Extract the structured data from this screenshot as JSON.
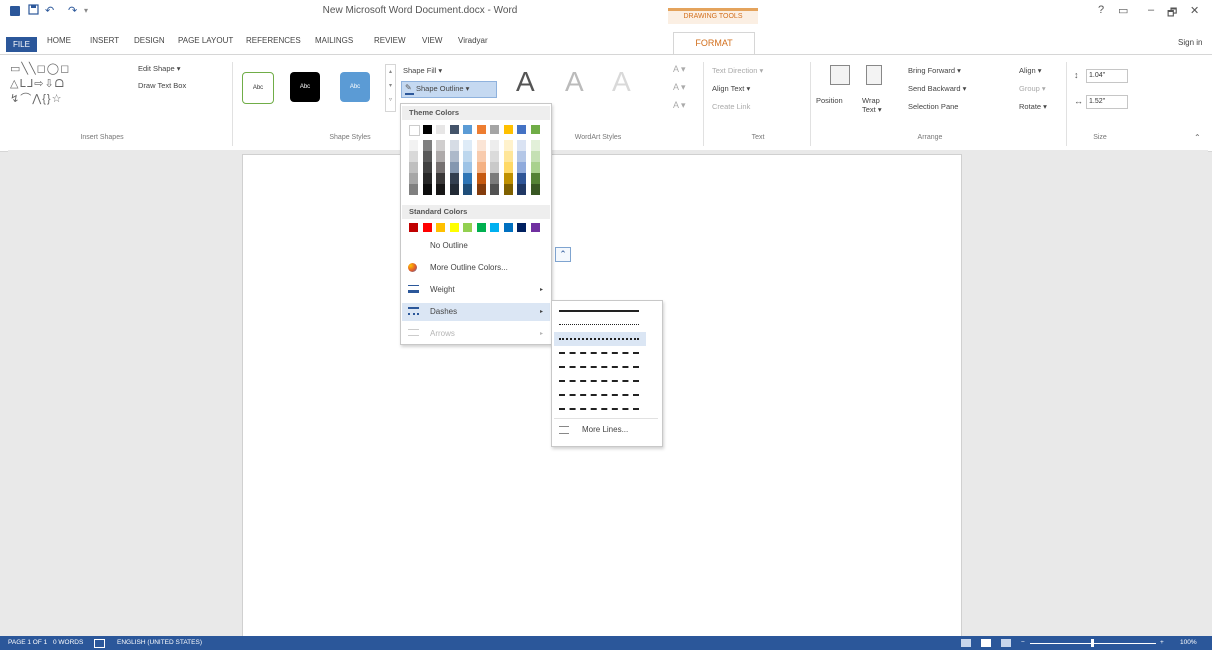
{
  "window": {
    "title": "New Microsoft Word Document.docx - Word",
    "contextual_group": "DRAWING TOOLS",
    "help": "?",
    "controls": [
      "▭",
      "–",
      "🗗",
      "✕"
    ],
    "sign_in": "Sign in"
  },
  "quick_access": {
    "undo": "↶",
    "redo": "↷",
    "more": "▾"
  },
  "tabs": [
    "FILE",
    "HOME",
    "INSERT",
    "DESIGN",
    "PAGE LAYOUT",
    "REFERENCES",
    "MAILINGS",
    "REVIEW",
    "VIEW",
    "Viradyar",
    "FORMAT"
  ],
  "ribbon": {
    "insert_shapes": {
      "label": "Insert Shapes",
      "edit_shape": "Edit Shape ▾",
      "draw_text_box": "Draw Text Box"
    },
    "shape_styles": {
      "label": "Shape Styles",
      "style_label": "Abc",
      "shape_fill": "Shape Fill ▾",
      "shape_outline": "Shape Outline ▾"
    },
    "wordart_styles": {
      "label": "WordArt Styles",
      "letter": "A"
    },
    "text": {
      "label": "Text",
      "text_direction": "Text Direction ▾",
      "align_text": "Align Text ▾",
      "create_link": "Create Link"
    },
    "arrange": {
      "label": "Arrange",
      "position": "Position",
      "wrap_text": "Wrap Text ▾",
      "bring_forward": "Bring Forward ▾",
      "send_backward": "Send Backward ▾",
      "selection_pane": "Selection Pane",
      "align": "Align ▾",
      "group": "Group ▾",
      "rotate": "Rotate ▾"
    },
    "size": {
      "label": "Size",
      "height": "1.04\"",
      "width": "1.52\""
    }
  },
  "outline_menu": {
    "theme_colors_header": "Theme Colors",
    "standard_colors_header": "Standard Colors",
    "items": [
      {
        "label": "No Outline",
        "icon": "none"
      },
      {
        "label": "More Outline Colors...",
        "icon": "palette-icon"
      },
      {
        "label": "Weight",
        "icon": "weight-icon",
        "submenu": true
      },
      {
        "label": "Dashes",
        "icon": "dashes-icon",
        "submenu": true,
        "highlighted": true
      },
      {
        "label": "Arrows",
        "icon": "arrows-icon",
        "submenu": true,
        "disabled": true
      }
    ],
    "theme_top_row": [
      "#ffffff",
      "#000000",
      "#e7e6e6",
      "#44546a",
      "#5b9bd5",
      "#ed7d31",
      "#a5a5a5",
      "#ffc000",
      "#4472c4",
      "#70ad47"
    ],
    "theme_columns": [
      [
        "#f2f2f2",
        "#d9d9d9",
        "#bfbfbf",
        "#a6a6a6",
        "#808080"
      ],
      [
        "#7f7f7f",
        "#595959",
        "#404040",
        "#262626",
        "#0d0d0d"
      ],
      [
        "#d0cece",
        "#aeaaaa",
        "#767171",
        "#3a3838",
        "#171616"
      ],
      [
        "#d6dce5",
        "#adb9ca",
        "#8497b0",
        "#333f50",
        "#222a35"
      ],
      [
        "#deebf7",
        "#bdd7ee",
        "#9dc3e6",
        "#2e75b6",
        "#1f4e79"
      ],
      [
        "#fbe5d6",
        "#f8cbad",
        "#f4b183",
        "#c55a11",
        "#843c0c"
      ],
      [
        "#ededed",
        "#dbdbdb",
        "#c9c9c9",
        "#7b7b7b",
        "#525252"
      ],
      [
        "#fff2cc",
        "#ffe699",
        "#ffd966",
        "#bf9000",
        "#7f6000"
      ],
      [
        "#dae3f3",
        "#b4c7e7",
        "#8faadc",
        "#2f5597",
        "#203864"
      ],
      [
        "#e2f0d9",
        "#c5e0b4",
        "#a9d18e",
        "#548235",
        "#385723"
      ]
    ],
    "standard_colors": [
      "#c00000",
      "#ff0000",
      "#ffc000",
      "#ffff00",
      "#92d050",
      "#00b050",
      "#00b0f0",
      "#0070c0",
      "#002060",
      "#7030a0"
    ]
  },
  "dashes_menu": {
    "styles": [
      "solid",
      "round-dot",
      "square-dot",
      "dash",
      "dash-dot",
      "long-dash",
      "long-dash-dot",
      "long-dash-dot-dot"
    ],
    "highlighted_index": 2,
    "more_lines": "More Lines..."
  },
  "status_bar": {
    "page": "PAGE 1 OF 1",
    "words": "0 WORDS",
    "language": "ENGLISH (UNITED STATES)",
    "zoom": "100%"
  },
  "colors": {
    "accent": "#2b579a",
    "format_tab": "#d26f1d",
    "highlight": "#dbe6f4"
  }
}
